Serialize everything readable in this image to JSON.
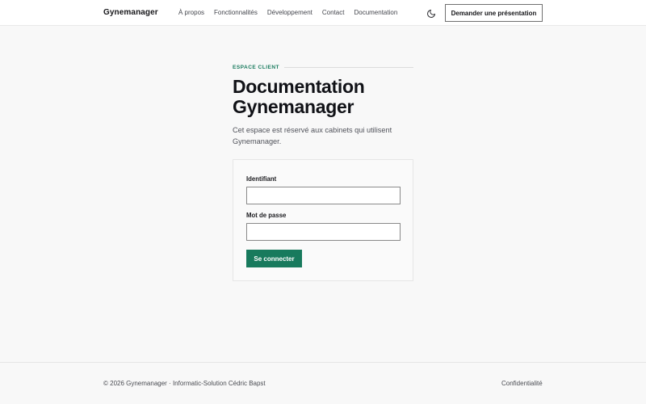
{
  "header": {
    "brand": "Gynemanager",
    "nav": [
      "À propos",
      "Fonctionnalités",
      "Développement",
      "Contact",
      "Documentation"
    ],
    "theme_toggle_icon": "moon-icon",
    "cta_label": "Demander une présentation"
  },
  "main": {
    "eyebrow": "ESPACE CLIENT",
    "title_line1": "Documentation",
    "title_line2": "Gynemanager",
    "subtitle": "Cet espace est réservé aux cabinets qui utilisent Gynemanager.",
    "form": {
      "username_label": "Identifiant",
      "username_value": "",
      "password_label": "Mot de passe",
      "password_value": "",
      "submit_label": "Se connecter"
    }
  },
  "footer": {
    "copyright": "© 2026 Gynemanager · Informatic-Solution Cédric Bapst",
    "privacy_link": "Confidentialité"
  },
  "colors": {
    "accent": "#187a5d",
    "background": "#f8f8f8",
    "header_background": "#ffffff",
    "text": "#111217"
  }
}
